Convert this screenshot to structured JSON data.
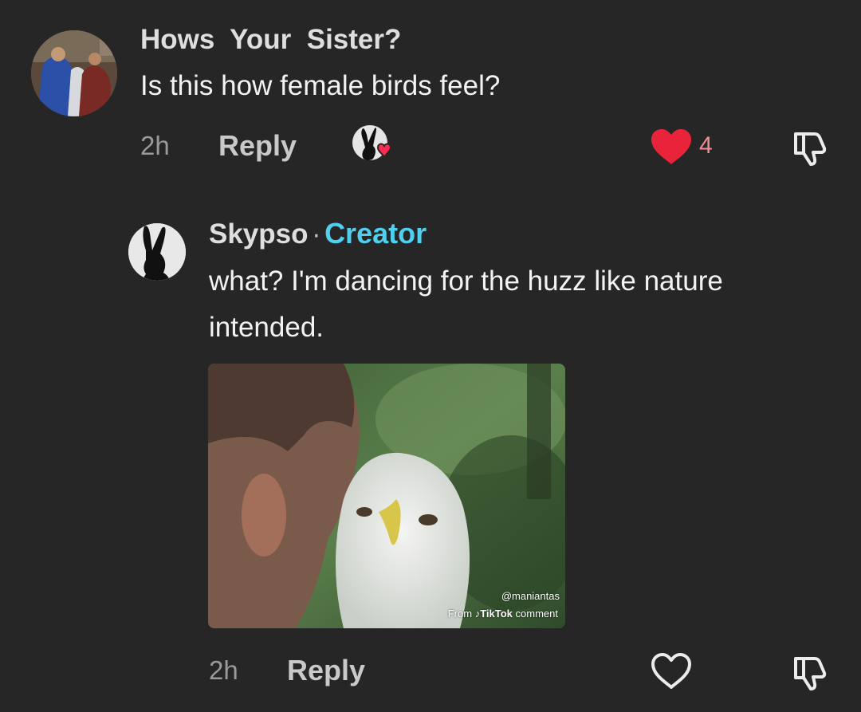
{
  "comment": {
    "username": "Hows  Your  Sister?",
    "text": "Is this how female birds feel?",
    "time": "2h",
    "reply_label": "Reply",
    "like_count": "4",
    "liked": true,
    "liked_by_creator": true,
    "like_color": "#e8233a"
  },
  "reply": {
    "username": "Skypso",
    "separator": "·",
    "badge": "Creator",
    "badge_color": "#4fd0ee",
    "text": "what? I'm dancing for the huzz like nature intended.",
    "time": "2h",
    "reply_label": "Reply",
    "liked": false,
    "gif": {
      "watermark_handle": "@maniantas",
      "watermark_from": "From",
      "watermark_brand": "TikTok",
      "watermark_suffix": "comment"
    }
  },
  "icons": {
    "like_filled": "heart-filled-icon",
    "like_outline": "heart-outline-icon",
    "dislike": "thumbs-down-icon",
    "tiktok_note": "tiktok-note-icon"
  }
}
